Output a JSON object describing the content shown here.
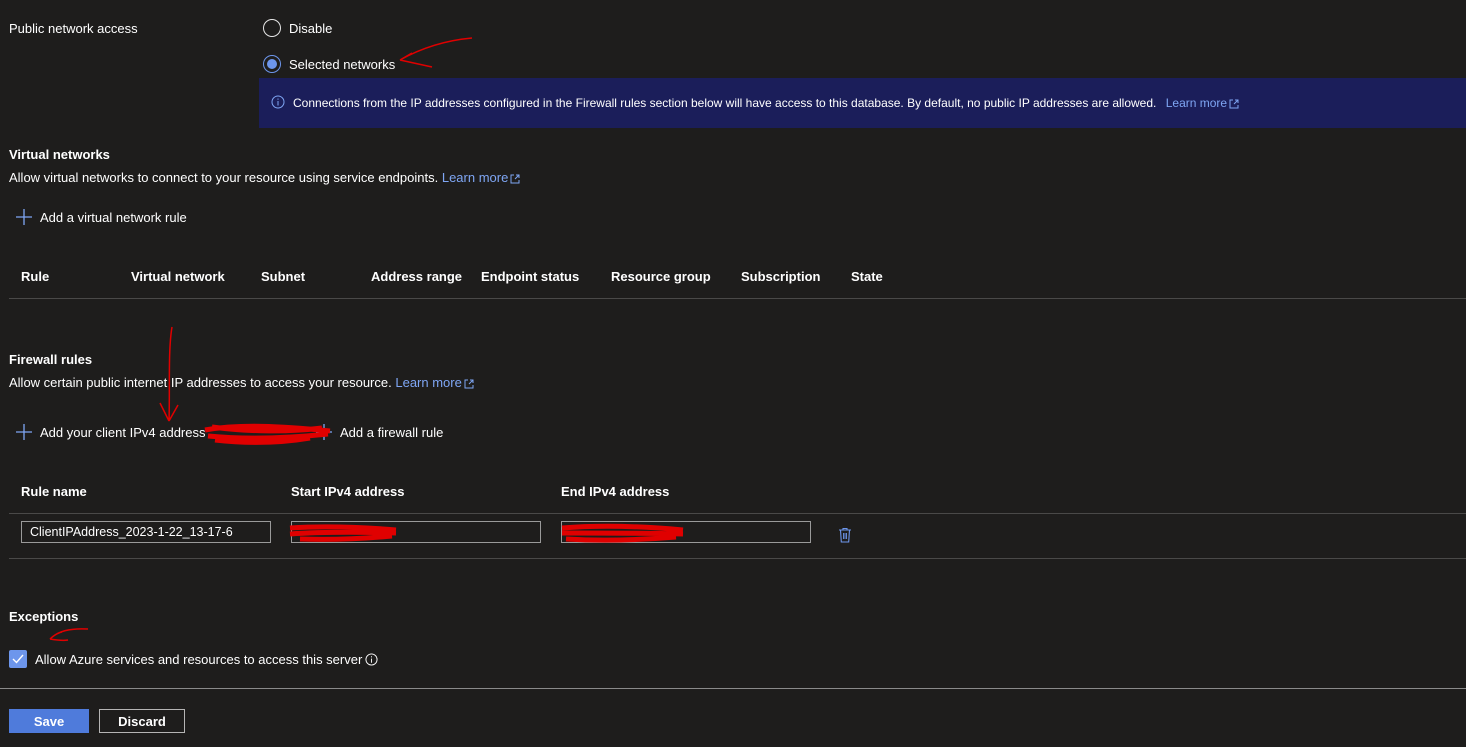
{
  "colors": {
    "background": "#1e1d1c",
    "accent": "#6d96ec",
    "link": "#7fa6f4",
    "info_bar": "#1b1e5a",
    "primary_button": "#4f7bdb",
    "annotation": "#e00000"
  },
  "public_access": {
    "label": "Public network access",
    "options": [
      {
        "label": "Disable",
        "selected": false
      },
      {
        "label": "Selected networks",
        "selected": true
      }
    ],
    "info": {
      "text": "Connections from the IP addresses configured in the Firewall rules section below will have access to this database. By default, no public IP addresses are allowed.",
      "link": "Learn more",
      "icon": "info-icon"
    }
  },
  "virtual_networks": {
    "title": "Virtual networks",
    "description": "Allow virtual networks to connect to your resource using service endpoints.",
    "link": "Learn more",
    "add_label": "Add a virtual network rule",
    "columns": [
      "Rule",
      "Virtual network",
      "Subnet",
      "Address range",
      "Endpoint status",
      "Resource group",
      "Subscription",
      "State"
    ]
  },
  "firewall_rules": {
    "title": "Firewall rules",
    "description": "Allow certain public internet IP addresses to access your resource.",
    "link": "Learn more",
    "add_client_label": "Add your client IPv4 address",
    "add_rule_label": "Add a firewall rule",
    "columns": [
      "Rule name",
      "Start IPv4 address",
      "End IPv4 address"
    ],
    "rows": [
      {
        "rule_name": "ClientIPAddress_2023-1-22_13-17-6",
        "start_ip": "",
        "end_ip": ""
      }
    ]
  },
  "exceptions": {
    "title": "Exceptions",
    "checkbox_label": "Allow Azure services and resources to access this server",
    "checked": true
  },
  "footer": {
    "save_label": "Save",
    "discard_label": "Discard"
  }
}
